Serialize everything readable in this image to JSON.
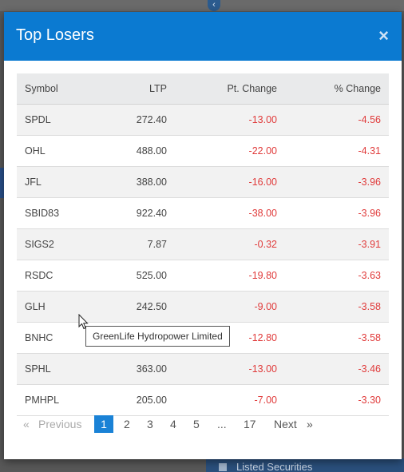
{
  "modal": {
    "title": "Top Losers",
    "close_icon": "×"
  },
  "table": {
    "columns": [
      "Symbol",
      "LTP",
      "Pt. Change",
      "% Change"
    ],
    "rows": [
      {
        "symbol": "SPDL",
        "ltp": "272.40",
        "pt_change": "-13.00",
        "pct_change": "-4.56"
      },
      {
        "symbol": "OHL",
        "ltp": "488.00",
        "pt_change": "-22.00",
        "pct_change": "-4.31"
      },
      {
        "symbol": "JFL",
        "ltp": "388.00",
        "pt_change": "-16.00",
        "pct_change": "-3.96"
      },
      {
        "symbol": "SBID83",
        "ltp": "922.40",
        "pt_change": "-38.00",
        "pct_change": "-3.96"
      },
      {
        "symbol": "SIGS2",
        "ltp": "7.87",
        "pt_change": "-0.32",
        "pct_change": "-3.91"
      },
      {
        "symbol": "RSDC",
        "ltp": "525.00",
        "pt_change": "-19.80",
        "pct_change": "-3.63"
      },
      {
        "symbol": "GLH",
        "ltp": "242.50",
        "pt_change": "-9.00",
        "pct_change": "-3.58"
      },
      {
        "symbol": "BNHC",
        "ltp": "",
        "pt_change": "-12.80",
        "pct_change": "-3.58"
      },
      {
        "symbol": "SPHL",
        "ltp": "363.00",
        "pt_change": "-13.00",
        "pct_change": "-3.46"
      },
      {
        "symbol": "PMHPL",
        "ltp": "205.00",
        "pt_change": "-7.00",
        "pct_change": "-3.30"
      }
    ]
  },
  "pagination": {
    "prev_arrow": "«",
    "prev_label": "Previous",
    "pages": [
      "1",
      "2",
      "3",
      "4",
      "5"
    ],
    "ellipsis": "...",
    "last_page": "17",
    "next_label": "Next",
    "next_arrow": "»",
    "active_page": "1"
  },
  "tooltip": {
    "text": "GreenLife Hydropower Limited"
  },
  "background": {
    "bottom_nav_label": "Listed Securities"
  },
  "colors": {
    "header_blue": "#0b7ad1",
    "negative_red": "#e03b3b",
    "active_page_blue": "#1a82d6"
  }
}
